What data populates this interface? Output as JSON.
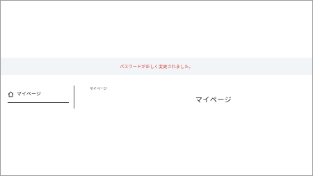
{
  "notice": {
    "message": "パスワードが正しく変更されました。"
  },
  "sidebar": {
    "items": [
      {
        "label": "マイページ",
        "icon": "home-icon"
      }
    ]
  },
  "breadcrumb": {
    "current": "マイページ"
  },
  "page": {
    "title": "マイページ"
  },
  "colors": {
    "notice_text": "#d9342b",
    "notice_background": "#f2f5f8"
  }
}
